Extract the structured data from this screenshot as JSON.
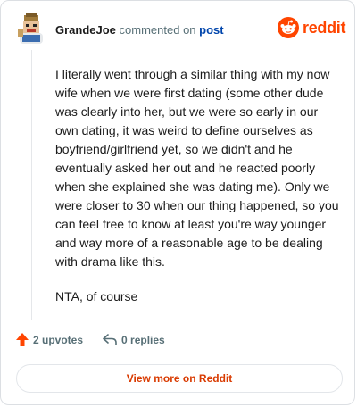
{
  "header": {
    "username": "GrandeJoe",
    "commented_on": "commented on",
    "post_link": "post",
    "brand": "reddit"
  },
  "comment": {
    "paragraphs": [
      "I literally went through a similar thing with my now wife when we were first dating (some other dude was clearly into her, but we were so early in our own dating, it was weird to define ourselves as boyfriend/girlfriend yet, so we didn't and he eventually asked her out and he reacted poorly when she explained she was dating me). Only we were closer to 30 when our thing happened, so you can feel free to know at least you're way younger and way more of a reasonable age to be dealing with drama like this.",
      "NTA, of course"
    ]
  },
  "actions": {
    "upvotes": "2 upvotes",
    "replies": "0 replies"
  },
  "footer": {
    "view_more": "View more on Reddit"
  },
  "colors": {
    "brand": "#ff4500",
    "link": "#0045ac",
    "muted": "#576f76",
    "view_more": "#d93a00"
  },
  "icons": [
    "avatar-image",
    "reddit-logo-icon",
    "upvote-arrow-icon",
    "reply-arrow-icon"
  ]
}
